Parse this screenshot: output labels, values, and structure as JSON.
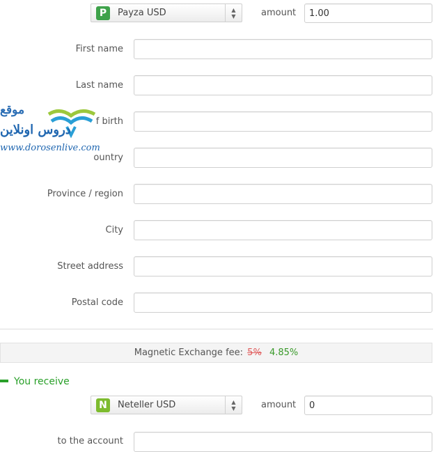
{
  "send": {
    "currency": "Payza USD",
    "currency_logo_letter": "P",
    "currency_logo_color": "#3ea24a",
    "amount_label": "amount",
    "amount_value": "1.00"
  },
  "form": {
    "first_name_label": "First name",
    "last_name_label": "Last name",
    "birth_label": "f birth",
    "country_label": "ountry",
    "province_label": "Province / region",
    "city_label": "City",
    "street_label": "Street address",
    "postal_label": "Postal code"
  },
  "fee": {
    "label": "Magnetic Exchange fee:",
    "old": "5%",
    "new": "4.85%",
    "old_color": "#e05a5a",
    "new_color": "#3a9a2a"
  },
  "receive": {
    "title": "You receive",
    "currency": "Neteller USD",
    "currency_logo_letter": "N",
    "currency_logo_color": "#7dbb2e",
    "amount_label": "amount",
    "amount_value": "0",
    "account_label": "to the account",
    "accent_color": "#2aa02a"
  },
  "watermark": {
    "arabic_line1": "موقع",
    "arabic_line2": "دروس اونلاين",
    "url": "www.dorosenlive.com"
  }
}
